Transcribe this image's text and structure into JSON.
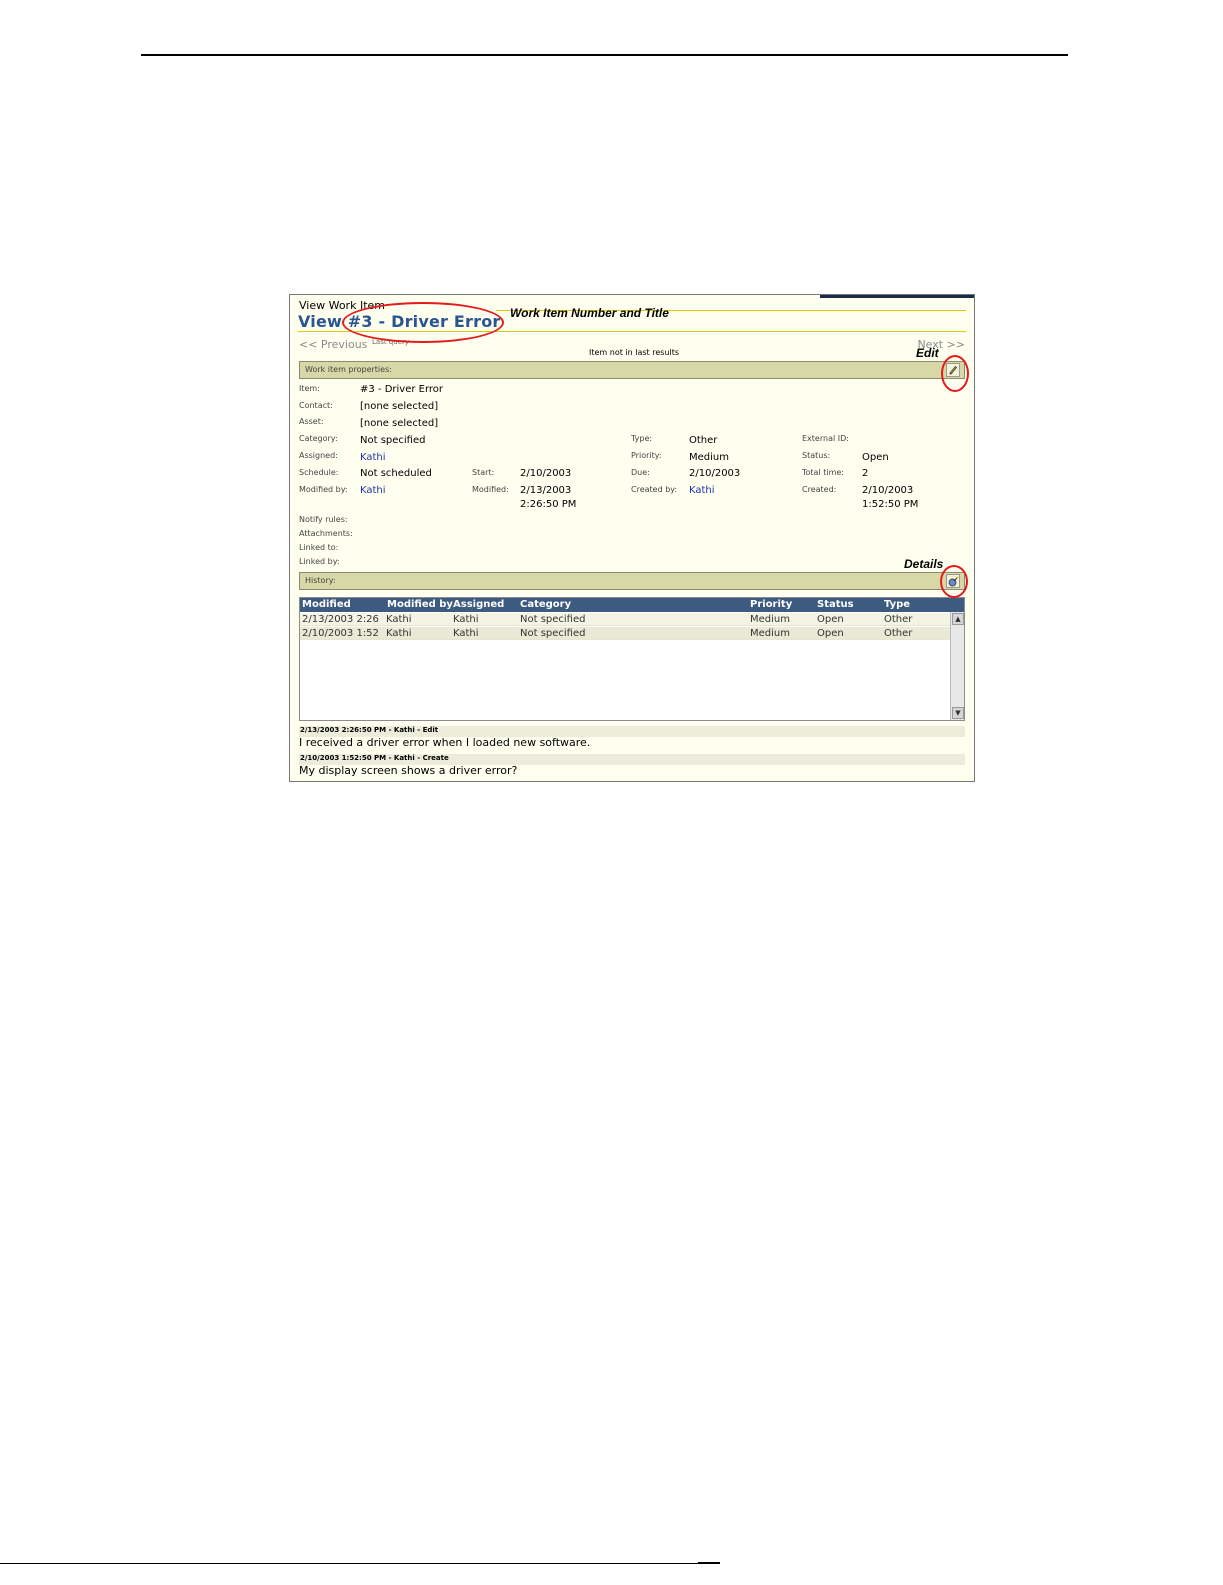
{
  "document": {
    "page_top_rule": true
  },
  "window": {
    "breadcrumb": "View Work Item",
    "title": "View #3 - Driver Error"
  },
  "navigation": {
    "previous": "<< Previous",
    "last_query": "Last query",
    "next": "Next >>",
    "notice": "Item not in last results"
  },
  "properties_section": {
    "header": "Work item properties:",
    "edit_icon": "pencil-icon"
  },
  "properties": {
    "item_label": "Item:",
    "item_value": "#3 - Driver Error",
    "contact_label": "Contact:",
    "contact_value": "[none selected]",
    "asset_label": "Asset:",
    "asset_value": "[none selected]",
    "category_label": "Category:",
    "category_value": "Not specified",
    "type_label": "Type:",
    "type_value": "Other",
    "external_id_label": "External ID:",
    "assigned_label": "Assigned:",
    "assigned_value": "Kathi",
    "priority_label": "Priority:",
    "priority_value": "Medium",
    "status_label": "Status:",
    "status_value": "Open",
    "schedule_label": "Schedule:",
    "schedule_value": "Not scheduled",
    "start_label": "Start:",
    "start_value": "2/10/2003",
    "due_label": "Due:",
    "due_value": "2/10/2003",
    "total_time_label": "Total time:",
    "total_time_value": "2",
    "modified_by_label": "Modified by:",
    "modified_by_value": "Kathi",
    "modified_label": "Modified:",
    "modified_value_1": "2/13/2003",
    "modified_value_2": "2:26:50 PM",
    "created_by_label": "Created by:",
    "created_by_value": "Kathi",
    "created_label": "Created:",
    "created_value_1": "2/10/2003",
    "created_value_2": "1:52:50 PM",
    "notify_rules_label": "Notify rules:",
    "attachments_label": "Attachments:",
    "linked_to_label": "Linked to:",
    "linked_by_label": "Linked by:"
  },
  "history_section": {
    "header": "History:",
    "details_icon": "details-icon"
  },
  "history_table": {
    "columns": [
      "Modified",
      "Modified by",
      "Assigned",
      "Category",
      "Priority",
      "Status",
      "Type"
    ],
    "rows": [
      [
        "2/13/2003 2:26",
        "Kathi",
        "Kathi",
        "Not specified",
        "Medium",
        "Open",
        "Other"
      ],
      [
        "2/10/2003 1:52",
        "Kathi",
        "Kathi",
        "Not specified",
        "Medium",
        "Open",
        "Other"
      ]
    ]
  },
  "notes": [
    {
      "header": "2/13/2003 2:26:50 PM - Kathi - Edit",
      "text": "I received a driver error when I loaded new software."
    },
    {
      "header": "2/10/2003 1:52:50 PM - Kathi - Create",
      "text": "My display screen shows a driver error?"
    }
  ],
  "annotations": {
    "title_callout": "Work Item Number and Title",
    "edit_callout": "Edit",
    "details_callout": "Details",
    "highlight_color": "#e31b1b"
  }
}
